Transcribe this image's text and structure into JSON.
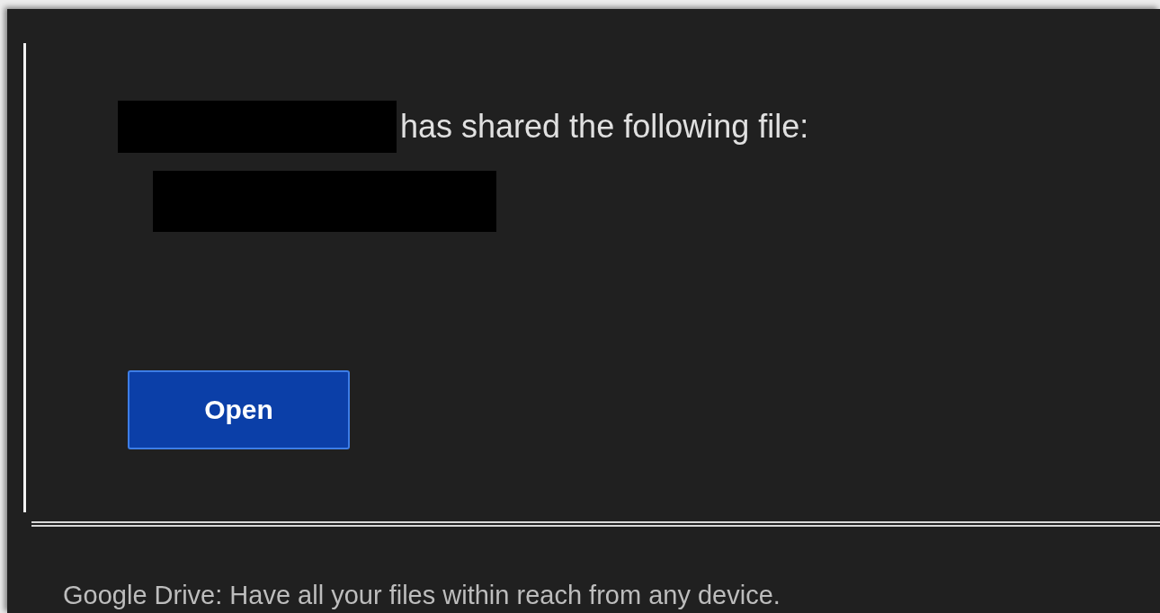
{
  "message": {
    "text": "has shared the following file:"
  },
  "button": {
    "label": "Open"
  },
  "footer": {
    "text": "Google Drive: Have all your files within reach from any device."
  }
}
